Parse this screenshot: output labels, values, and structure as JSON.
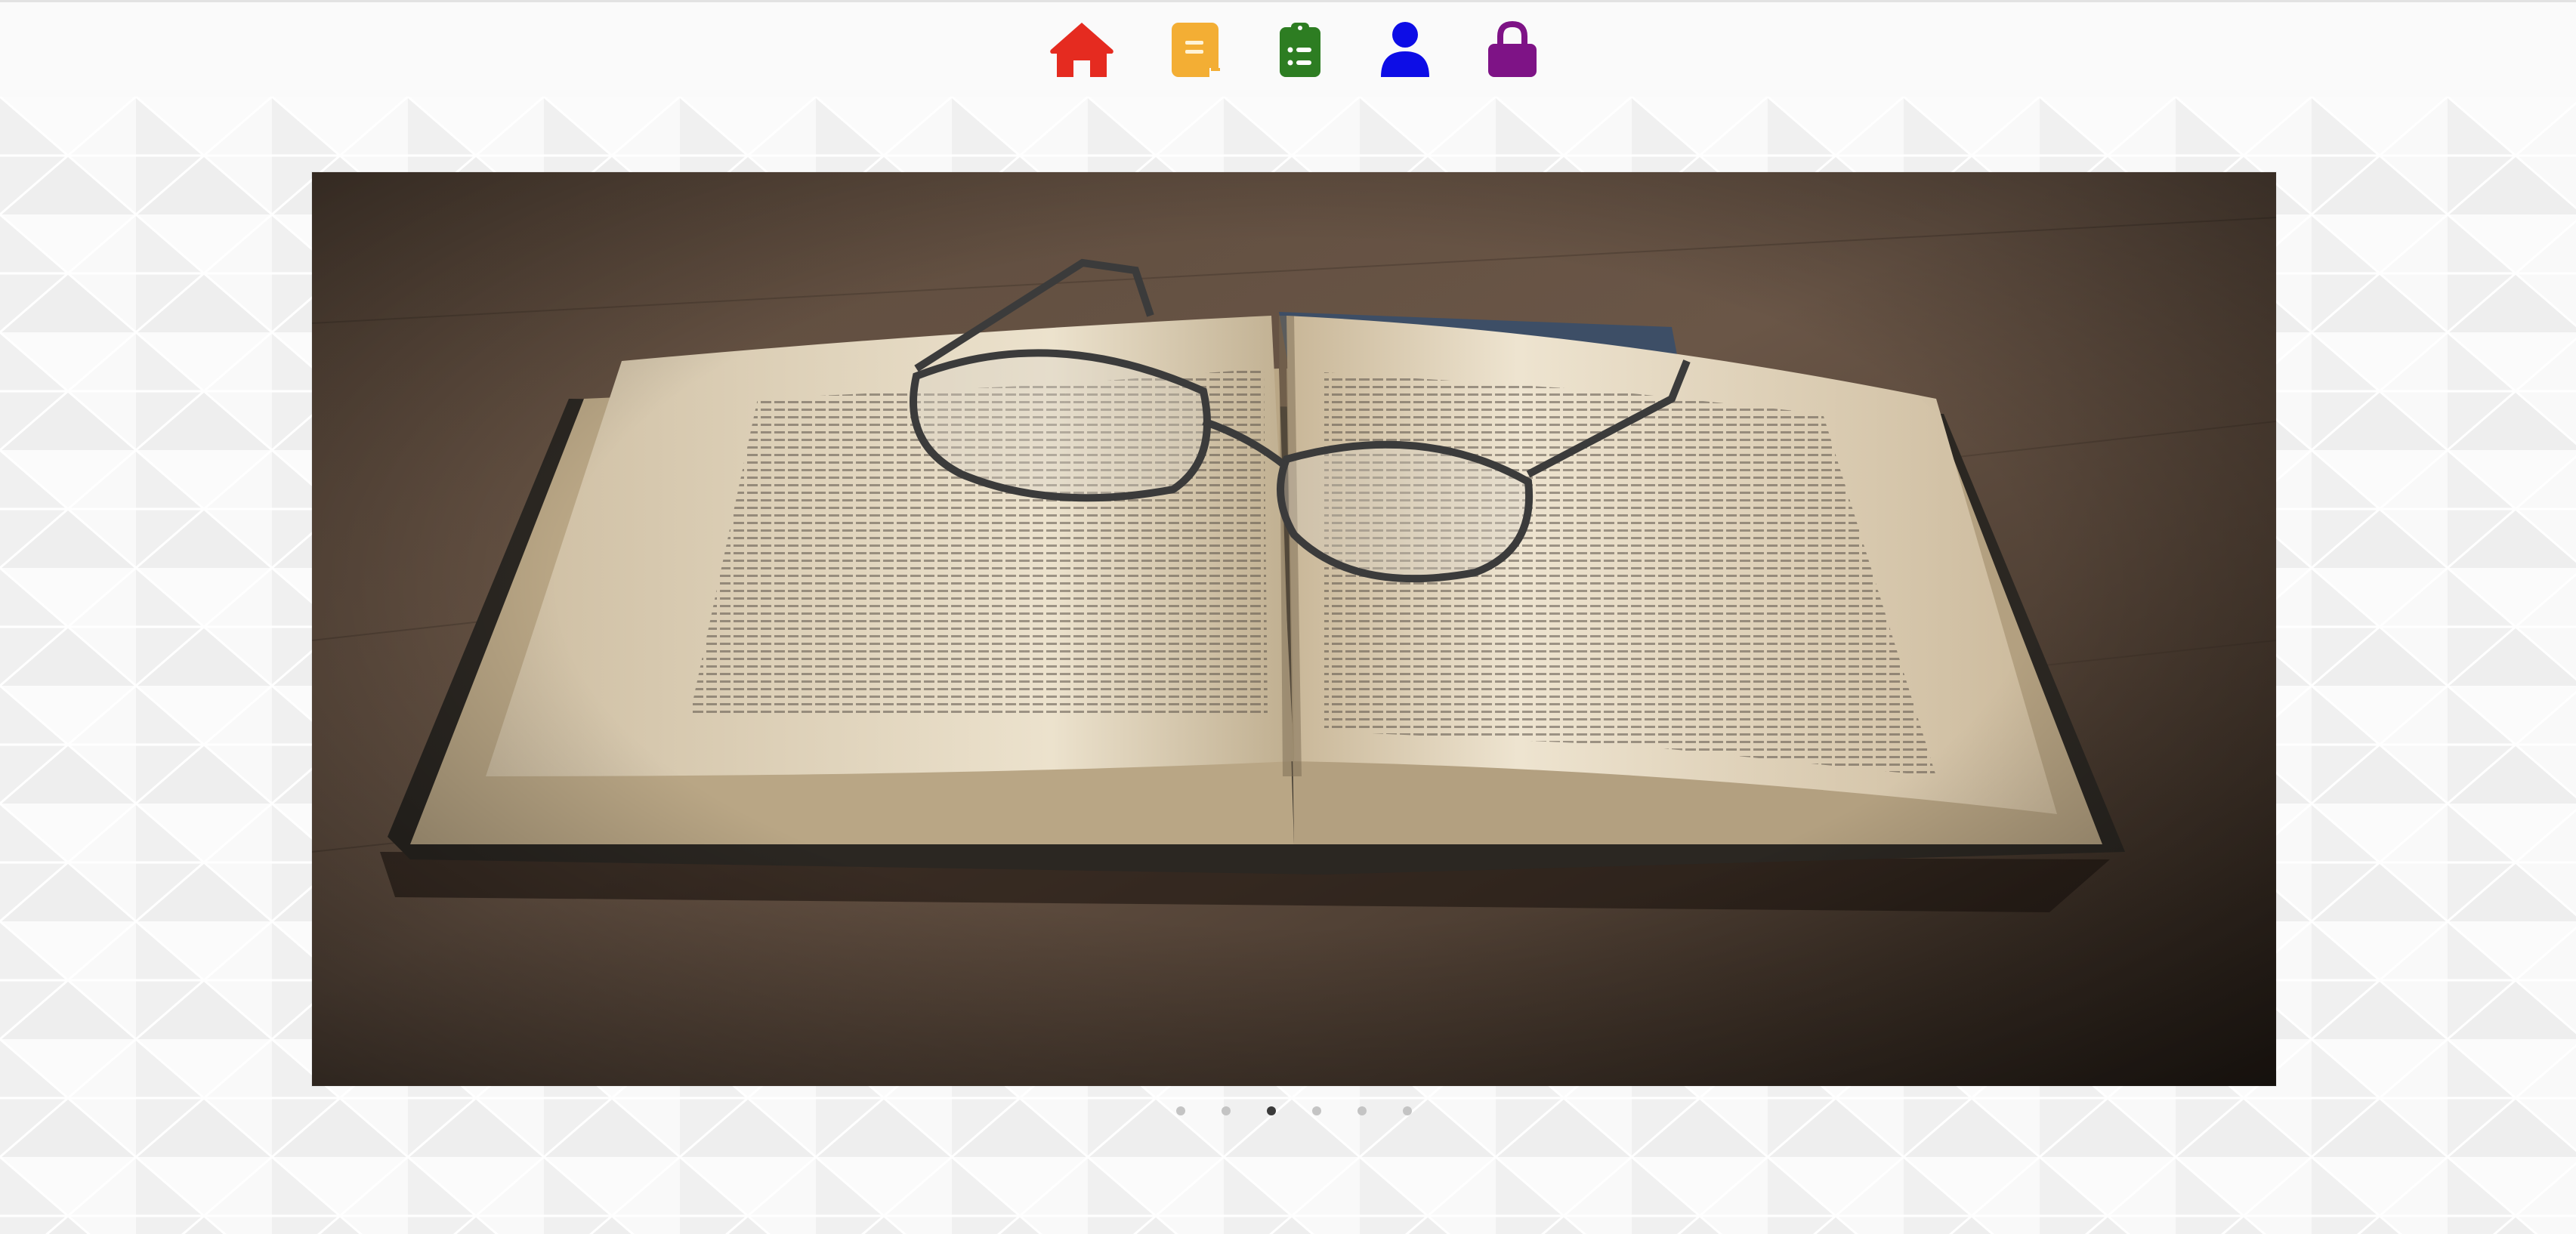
{
  "nav": {
    "items": [
      {
        "icon": "home-icon",
        "color": "#e52b20"
      },
      {
        "icon": "document-icon",
        "color": "#f3ae34"
      },
      {
        "icon": "clipboard-list-icon",
        "color": "#2d7d22"
      },
      {
        "icon": "user-icon",
        "color": "#0d0de6"
      },
      {
        "icon": "lock-icon",
        "color": "#7e1386"
      }
    ]
  },
  "carousel": {
    "slide": {
      "subject": "open-book-with-glasses-photo"
    },
    "slide_count": 6,
    "active_index": 2,
    "dot_color": "#c4c4c4",
    "dot_active_color": "#3a3a3a"
  },
  "colors": {
    "topbar_bg": "#fafafa",
    "page_bg": "#f4f4f4"
  }
}
